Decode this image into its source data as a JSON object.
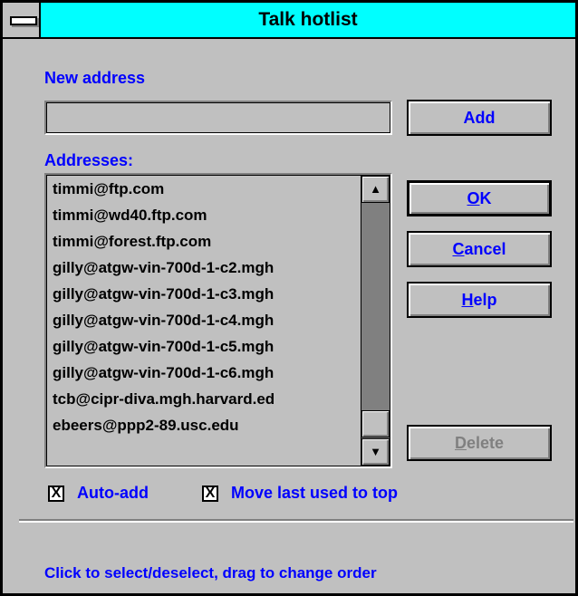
{
  "window": {
    "title": "Talk hotlist",
    "system_menu_icon": "minus-bar-icon"
  },
  "new_address": {
    "label": "New address",
    "value": "",
    "add_button": "Add"
  },
  "addresses": {
    "label": "Addresses:",
    "items": [
      "timmi@ftp.com",
      "timmi@wd40.ftp.com",
      "timmi@forest.ftp.com",
      "gilly@atgw-vin-700d-1-c2.mgh",
      "gilly@atgw-vin-700d-1-c3.mgh",
      "gilly@atgw-vin-700d-1-c4.mgh",
      "gilly@atgw-vin-700d-1-c5.mgh",
      "gilly@atgw-vin-700d-1-c6.mgh",
      "tcb@cipr-diva.mgh.harvard.ed",
      "ebeers@ppp2-89.usc.edu"
    ],
    "scroll_up_icon": "arrow-up-icon",
    "scroll_down_icon": "arrow-down-icon"
  },
  "buttons": {
    "ok": {
      "mnemonic": "O",
      "rest": "K"
    },
    "cancel": {
      "mnemonic": "C",
      "rest": "ancel"
    },
    "help": {
      "mnemonic": "H",
      "rest": "elp"
    },
    "delete": {
      "mnemonic": "D",
      "rest": "elete",
      "disabled": true
    }
  },
  "options": {
    "auto_add": {
      "label": "Auto-add",
      "checked": true,
      "mark": "X"
    },
    "move_last": {
      "label": "Move last used to top",
      "checked": true,
      "mark": "X"
    }
  },
  "status_text": "Click to select/deselect, drag to change order",
  "colors": {
    "title_bar": "#00ffff",
    "label_text": "#0000ff",
    "face": "#c0c0c0"
  }
}
